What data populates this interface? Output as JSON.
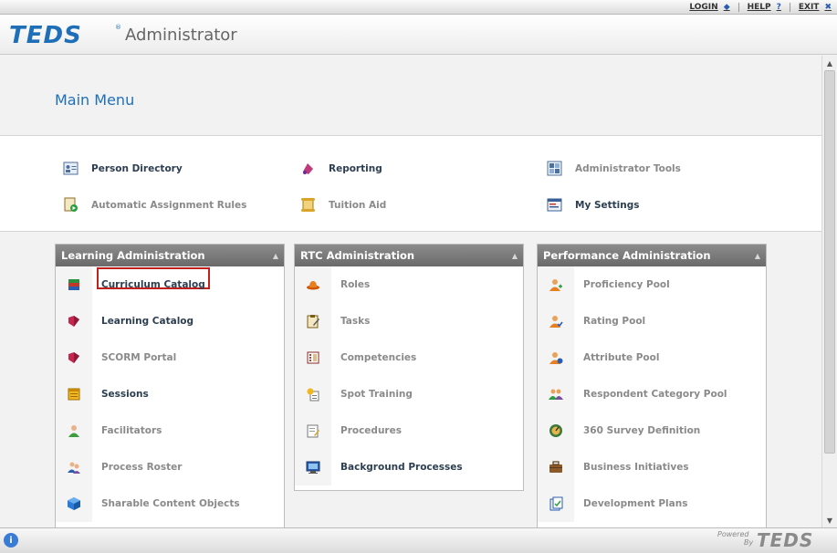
{
  "top_nav": {
    "login": "LOGIN",
    "help": "HELP",
    "exit": "EXIT"
  },
  "header": {
    "logo": "TEDS",
    "registered": "®",
    "title": "Administrator"
  },
  "main_title": "Main Menu",
  "quick_links": {
    "person_directory": "Person Directory",
    "reporting": "Reporting",
    "administrator_tools": "Administrator Tools",
    "automatic_assignment_rules": "Automatic Assignment Rules",
    "tuition_aid": "Tuition Aid",
    "my_settings": "My Settings"
  },
  "learning": {
    "title": "Learning Administration",
    "items": [
      {
        "label": "Curriculum Catalog",
        "icon": "books-icon"
      },
      {
        "label": "Learning Catalog",
        "icon": "book-icon"
      },
      {
        "label": "SCORM Portal",
        "icon": "book-icon"
      },
      {
        "label": "Sessions",
        "icon": "calendar-icon"
      },
      {
        "label": "Facilitators",
        "icon": "person-icon"
      },
      {
        "label": "Process Roster",
        "icon": "people-icon"
      },
      {
        "label": "Sharable Content Objects",
        "icon": "cube-icon"
      }
    ]
  },
  "rtc": {
    "title": "RTC Administration",
    "items": [
      {
        "label": "Roles",
        "icon": "hat-icon"
      },
      {
        "label": "Tasks",
        "icon": "clipboard-icon"
      },
      {
        "label": "Competencies",
        "icon": "list-icon"
      },
      {
        "label": "Spot Training",
        "icon": "spot-icon"
      },
      {
        "label": "Procedures",
        "icon": "edit-document-icon"
      },
      {
        "label": "Background Processes",
        "icon": "monitor-icon"
      }
    ]
  },
  "performance": {
    "title": "Performance Administration",
    "items": [
      {
        "label": "Proficiency Pool",
        "icon": "user-add-icon"
      },
      {
        "label": "Rating Pool",
        "icon": "user-check-icon"
      },
      {
        "label": "Attribute Pool",
        "icon": "user-info-icon"
      },
      {
        "label": "Respondent Category Pool",
        "icon": "group-icon"
      },
      {
        "label": "360 Survey Definition",
        "icon": "gauge-icon"
      },
      {
        "label": "Business Initiatives",
        "icon": "briefcase-icon"
      },
      {
        "label": "Development Plans",
        "icon": "plans-icon"
      }
    ]
  },
  "footer": {
    "powered": "Powered",
    "by": "By",
    "logo": "TEDS"
  },
  "colors": {
    "accent": "#1f6fb8",
    "panel_header": "#7a7a7a",
    "highlight_border": "#c21f1f"
  }
}
